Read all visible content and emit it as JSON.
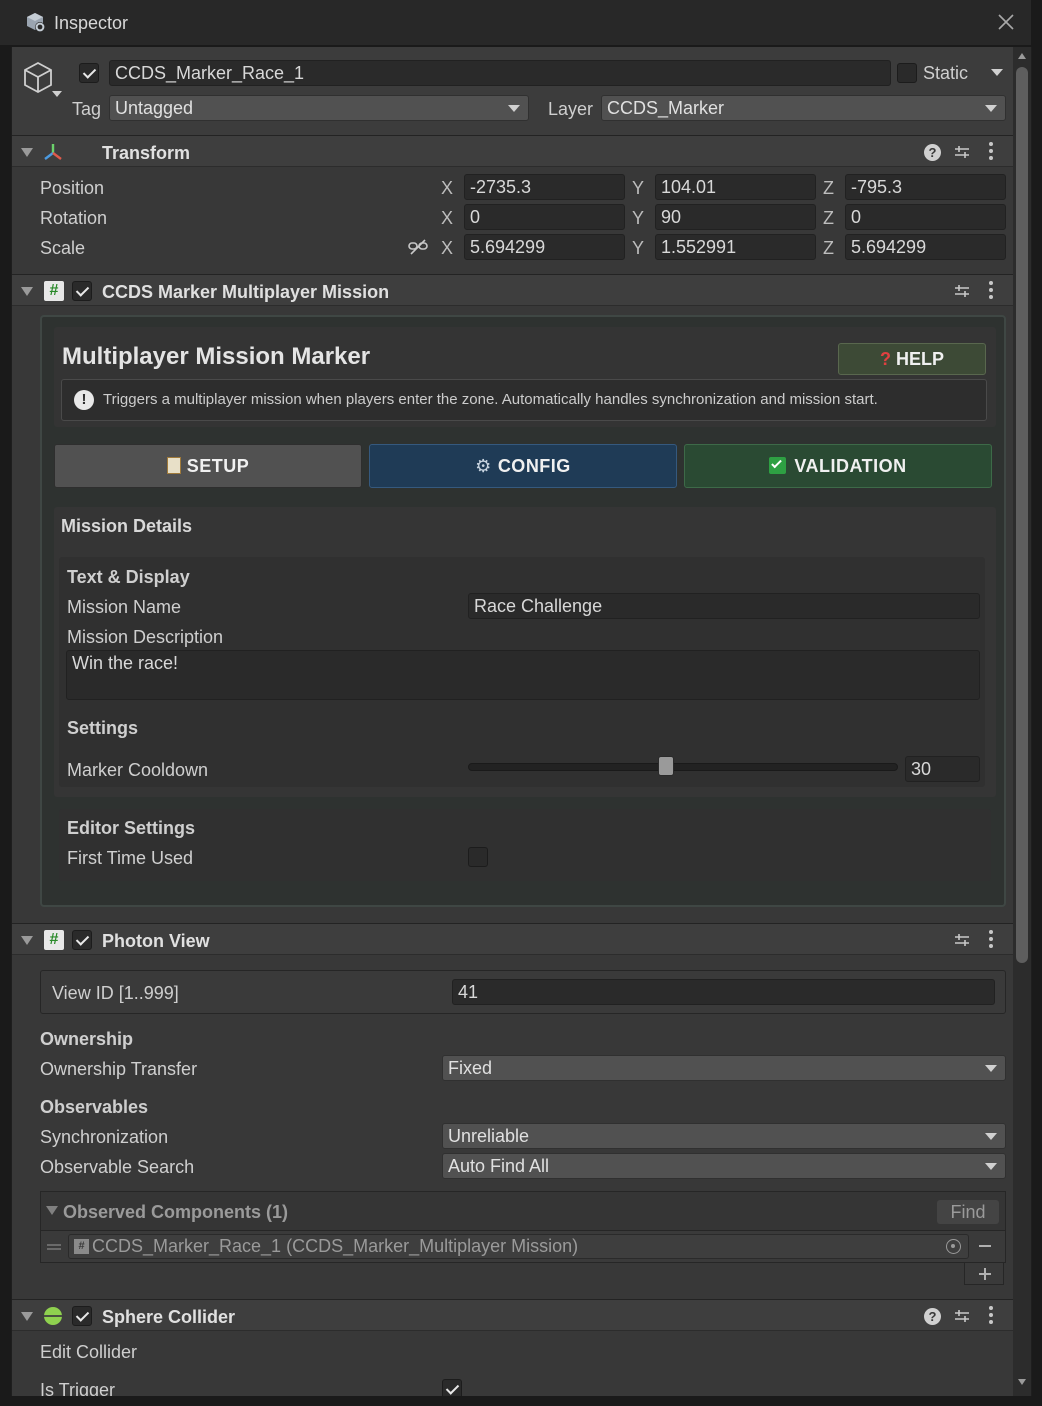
{
  "window": {
    "title": "Inspector"
  },
  "object": {
    "active": true,
    "name": "CCDS_Marker_Race_1",
    "static_label": "Static",
    "static": false,
    "tag_label": "Tag",
    "tag_value": "Untagged",
    "layer_label": "Layer",
    "layer_value": "CCDS_Marker"
  },
  "transform": {
    "title": "Transform",
    "rows": [
      {
        "label": "Position",
        "x": "-2735.3",
        "y": "104.01",
        "z": "-795.3"
      },
      {
        "label": "Rotation",
        "x": "0",
        "y": "90",
        "z": "0"
      },
      {
        "label": "Scale",
        "x": "5.694299",
        "y": "1.552991",
        "z": "5.694299"
      }
    ],
    "axes": {
      "x": "X",
      "y": "Y",
      "z": "Z"
    }
  },
  "mission": {
    "title": "CCDS Marker Multiplayer Mission",
    "enabled": true,
    "panel_title": "Multiplayer Mission Marker",
    "help_label": "HELP",
    "info_text": "Triggers a multiplayer mission when players enter the zone. Automatically handles synchronization and mission start.",
    "tabs": {
      "setup": "SETUP",
      "config": "CONFIG",
      "validation": "VALIDATION"
    },
    "details_title": "Mission Details",
    "text_display_title": "Text & Display",
    "mission_name_label": "Mission Name",
    "mission_name_value": "Race Challenge",
    "mission_description_label": "Mission Description",
    "mission_description_value": "Win the race!",
    "settings_title": "Settings",
    "cooldown_label": "Marker Cooldown",
    "cooldown_value": "30",
    "cooldown_fraction": 0.46,
    "editor_settings_title": "Editor Settings",
    "first_time_label": "First Time Used",
    "first_time_used": false
  },
  "photon": {
    "title": "Photon View",
    "enabled": true,
    "view_id_label": "View ID [1..999]",
    "view_id_value": "41",
    "ownership_title": "Ownership",
    "ownership_transfer_label": "Ownership Transfer",
    "ownership_transfer_value": "Fixed",
    "observables_title": "Observables",
    "synchronization_label": "Synchronization",
    "synchronization_value": "Unreliable",
    "observable_search_label": "Observable Search",
    "observable_search_value": "Auto Find All",
    "observed_title": "Observed Components (1)",
    "find_label": "Find",
    "observed_item": "CCDS_Marker_Race_1 (CCDS_Marker_Multiplayer Mission)"
  },
  "sphere": {
    "title": "Sphere Collider",
    "enabled": true,
    "edit_collider_label": "Edit Collider",
    "is_trigger_label": "Is Trigger",
    "is_trigger": true
  },
  "colors": {
    "setup": "#515151",
    "config": "#1f3b56",
    "validation": "#2a4a33",
    "help": "#3d4a36",
    "accent_check": "#2ea043"
  }
}
